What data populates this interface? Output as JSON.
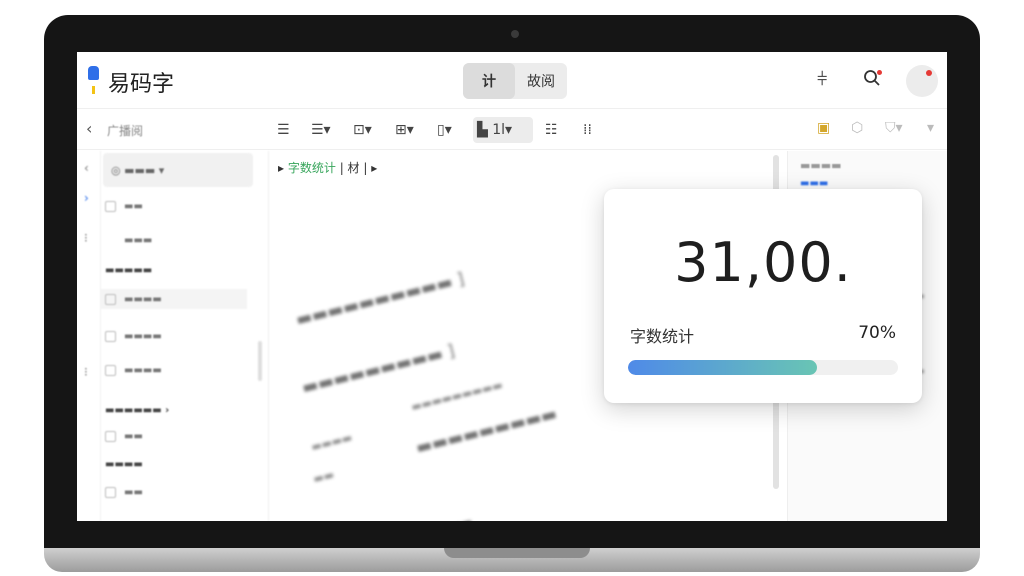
{
  "app": {
    "title": "易码字"
  },
  "header": {
    "mode_tabs": [
      "计",
      "故阅"
    ]
  },
  "editor": {
    "breadcrumb_active": "字数统计",
    "breadcrumb_rest": "| 材 |"
  },
  "word_count_card": {
    "number": "31,00.",
    "label": "字数统计",
    "percent_text": "70%",
    "progress": 0.7
  },
  "colors": {
    "accent": "#2f6fe8",
    "progress_start": "#4f8ae8",
    "progress_end": "#69c5b4",
    "notification": "#e53935"
  },
  "icons": {
    "sidebar_toggle": "chevron-left-icon",
    "search": "search-icon",
    "settings": "sliders-icon"
  }
}
